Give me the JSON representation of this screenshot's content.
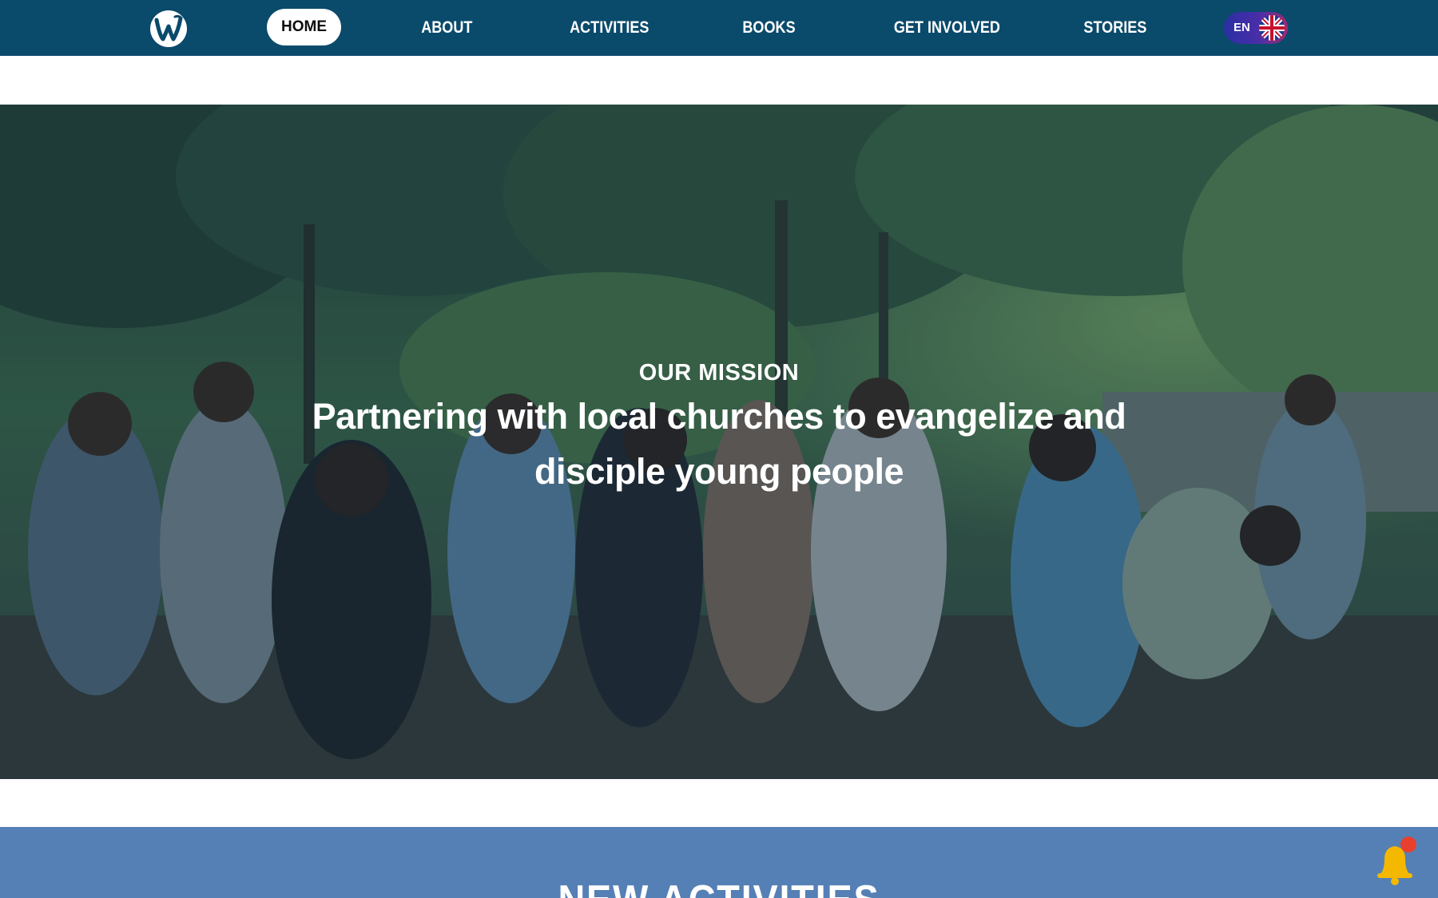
{
  "nav": {
    "logo_icon": "w-logo-icon",
    "items": [
      {
        "label": "HOME",
        "active": true
      },
      {
        "label": "ABOUT",
        "active": false
      },
      {
        "label": "ACTIVITIES",
        "active": false
      },
      {
        "label": "BOOKS",
        "active": false
      },
      {
        "label": "GET INVOLVED",
        "active": false
      },
      {
        "label": "STORIES",
        "active": false
      }
    ],
    "language": {
      "code": "EN",
      "flag_icon": "uk-flag-icon"
    }
  },
  "hero": {
    "eyebrow": "OUR MISSION",
    "title": "Partnering with local churches to evangelize and disciple young people",
    "image": "group-of-children-outdoors-photo"
  },
  "activities": {
    "title": "NEW ACTIVITIES"
  },
  "notification": {
    "icon": "bell-icon",
    "badge": "red-dot"
  },
  "colors": {
    "nav_bg": "#0a4a6b",
    "activities_bg": "#5580b5",
    "bell": "#f5b800",
    "badge": "#e8402f"
  }
}
